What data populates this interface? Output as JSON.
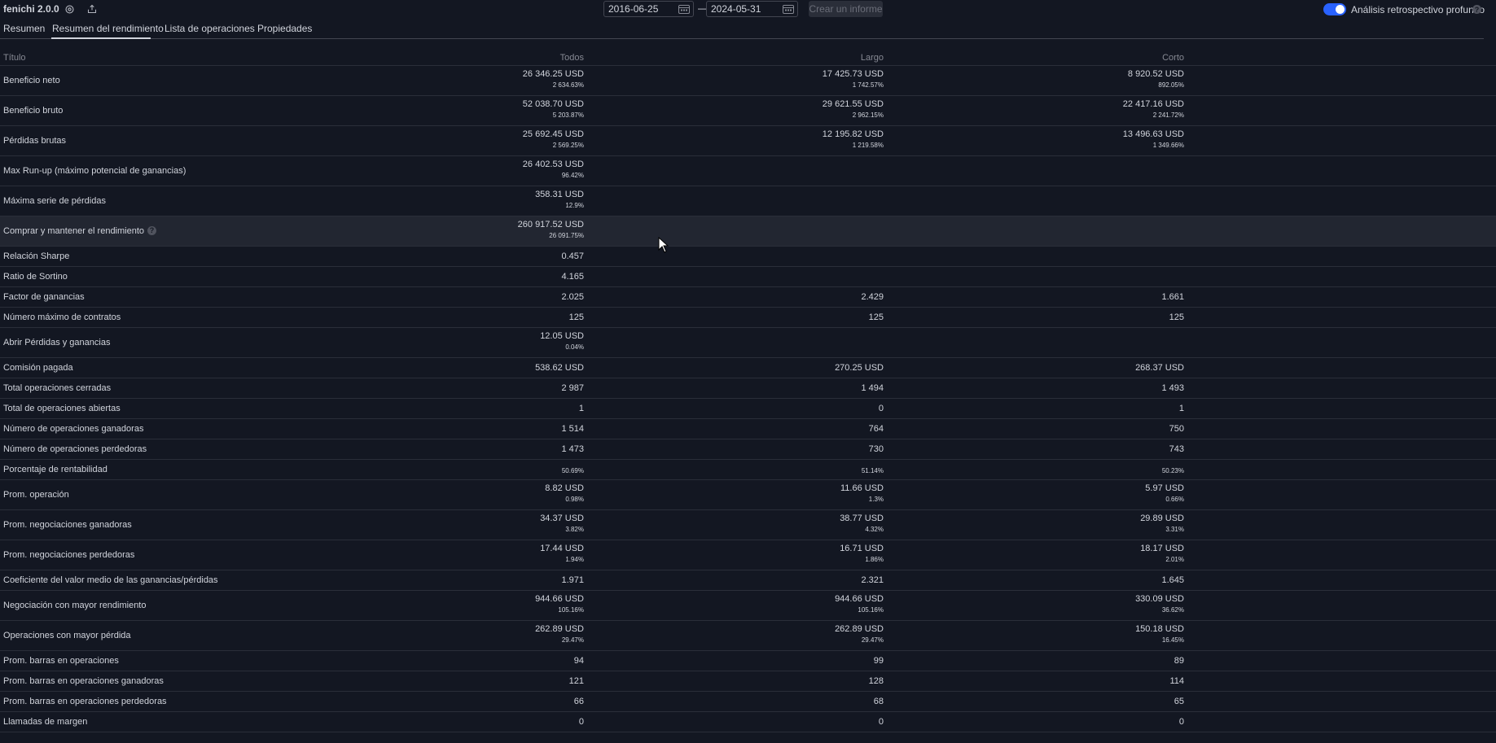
{
  "header": {
    "strategy_name": "fenichi 2.0.0",
    "settings_icon": "gear-icon",
    "export_icon": "export-icon",
    "date_from": "2016-06-25",
    "date_separator": "—",
    "date_to": "2024-05-31",
    "calendar_icon": "calendar-icon",
    "create_report_label": "Crear un informe",
    "deep_backtest_label": "Análisis retrospectivo profundo",
    "deep_backtest_enabled": true,
    "help_glyph": "?"
  },
  "tabs": [
    {
      "label": "Resumen",
      "active": false
    },
    {
      "label": "Resumen del rendimiento",
      "active": true
    },
    {
      "label": "Lista de operaciones",
      "active": false
    },
    {
      "label": "Propiedades",
      "active": false
    }
  ],
  "table": {
    "columns": [
      "Título",
      "Todos",
      "Largo",
      "Corto"
    ],
    "rows": [
      {
        "label": "Beneficio neto",
        "tall": true,
        "all": {
          "value": "26 346.25 USD",
          "pct": "2 634.63%"
        },
        "long": {
          "value": "17 425.73 USD",
          "pct": "1 742.57%"
        },
        "short": {
          "value": "8 920.52 USD",
          "pct": "892.05%"
        }
      },
      {
        "label": "Beneficio bruto",
        "tall": true,
        "all": {
          "value": "52 038.70 USD",
          "pct": "5 203.87%"
        },
        "long": {
          "value": "29 621.55 USD",
          "pct": "2 962.15%"
        },
        "short": {
          "value": "22 417.16 USD",
          "pct": "2 241.72%"
        }
      },
      {
        "label": "Pérdidas brutas",
        "tall": true,
        "all": {
          "value": "25 692.45 USD",
          "pct": "2 569.25%"
        },
        "long": {
          "value": "12 195.82 USD",
          "pct": "1 219.58%"
        },
        "short": {
          "value": "13 496.63 USD",
          "pct": "1 349.66%"
        }
      },
      {
        "label": "Max Run-up (máximo potencial de ganancias)",
        "tall": true,
        "all": {
          "value": "26 402.53 USD",
          "pct": "96.42%"
        }
      },
      {
        "label": "Máxima serie de pérdidas",
        "tall": true,
        "all": {
          "value": "358.31 USD",
          "pct": "12.9%"
        }
      },
      {
        "label": "Comprar y mantener el rendimiento",
        "tall": true,
        "help": true,
        "highlight": true,
        "all": {
          "value": "260 917.52 USD",
          "pct": "26 091.75%"
        }
      },
      {
        "label": "Relación Sharpe",
        "tall": false,
        "all": {
          "value": "0.457"
        }
      },
      {
        "label": "Ratio de Sortino",
        "tall": false,
        "all": {
          "value": "4.165"
        }
      },
      {
        "label": "Factor de ganancias",
        "tall": false,
        "all": {
          "value": "2.025"
        },
        "long": {
          "value": "2.429"
        },
        "short": {
          "value": "1.661"
        }
      },
      {
        "label": "Número máximo de contratos",
        "tall": false,
        "all": {
          "value": "125"
        },
        "long": {
          "value": "125"
        },
        "short": {
          "value": "125"
        }
      },
      {
        "label": "Abrir Pérdidas y ganancias",
        "tall": true,
        "all": {
          "value": "12.05 USD",
          "pct": "0.04%"
        }
      },
      {
        "label": "Comisión pagada",
        "tall": false,
        "all": {
          "value": "538.62 USD"
        },
        "long": {
          "value": "270.25 USD"
        },
        "short": {
          "value": "268.37 USD"
        }
      },
      {
        "label": "Total operaciones cerradas",
        "tall": false,
        "all": {
          "value": "2 987"
        },
        "long": {
          "value": "1 494"
        },
        "short": {
          "value": "1 493"
        }
      },
      {
        "label": "Total de operaciones abiertas",
        "tall": false,
        "all": {
          "value": "1"
        },
        "long": {
          "value": "0"
        },
        "short": {
          "value": "1"
        }
      },
      {
        "label": "Número de operaciones ganadoras",
        "tall": false,
        "all": {
          "value": "1 514"
        },
        "long": {
          "value": "764"
        },
        "short": {
          "value": "750"
        }
      },
      {
        "label": "Número de operaciones perdedoras",
        "tall": false,
        "all": {
          "value": "1 473"
        },
        "long": {
          "value": "730"
        },
        "short": {
          "value": "743"
        }
      },
      {
        "label": "Porcentaje de rentabilidad",
        "tall": false,
        "all": {
          "pct": "50.69%"
        },
        "long": {
          "pct": "51.14%"
        },
        "short": {
          "pct": "50.23%"
        }
      },
      {
        "label": "Prom. operación",
        "tall": true,
        "all": {
          "value": "8.82 USD",
          "pct": "0.98%"
        },
        "long": {
          "value": "11.66 USD",
          "pct": "1.3%"
        },
        "short": {
          "value": "5.97 USD",
          "pct": "0.66%"
        }
      },
      {
        "label": "Prom. negociaciones ganadoras",
        "tall": true,
        "all": {
          "value": "34.37 USD",
          "pct": "3.82%"
        },
        "long": {
          "value": "38.77 USD",
          "pct": "4.32%"
        },
        "short": {
          "value": "29.89 USD",
          "pct": "3.31%"
        }
      },
      {
        "label": "Prom. negociaciones perdedoras",
        "tall": true,
        "all": {
          "value": "17.44 USD",
          "pct": "1.94%"
        },
        "long": {
          "value": "16.71 USD",
          "pct": "1.86%"
        },
        "short": {
          "value": "18.17 USD",
          "pct": "2.01%"
        }
      },
      {
        "label": "Coeficiente del valor medio de las ganancias/pérdidas",
        "tall": false,
        "all": {
          "value": "1.971"
        },
        "long": {
          "value": "2.321"
        },
        "short": {
          "value": "1.645"
        }
      },
      {
        "label": "Negociación con mayor rendimiento",
        "tall": true,
        "all": {
          "value": "944.66 USD",
          "pct": "105.16%"
        },
        "long": {
          "value": "944.66 USD",
          "pct": "105.16%"
        },
        "short": {
          "value": "330.09 USD",
          "pct": "36.62%"
        }
      },
      {
        "label": "Operaciones con mayor pérdida",
        "tall": true,
        "all": {
          "value": "262.89 USD",
          "pct": "29.47%"
        },
        "long": {
          "value": "262.89 USD",
          "pct": "29.47%"
        },
        "short": {
          "value": "150.18 USD",
          "pct": "16.45%"
        }
      },
      {
        "label": "Prom. barras en operaciones",
        "tall": false,
        "all": {
          "value": "94"
        },
        "long": {
          "value": "99"
        },
        "short": {
          "value": "89"
        }
      },
      {
        "label": "Prom. barras en operaciones ganadoras",
        "tall": false,
        "all": {
          "value": "121"
        },
        "long": {
          "value": "128"
        },
        "short": {
          "value": "114"
        }
      },
      {
        "label": "Prom. barras en operaciones perdedoras",
        "tall": false,
        "all": {
          "value": "66"
        },
        "long": {
          "value": "68"
        },
        "short": {
          "value": "65"
        }
      },
      {
        "label": "Llamadas de margen",
        "tall": false,
        "all": {
          "value": "0"
        },
        "long": {
          "value": "0"
        },
        "short": {
          "value": "0"
        }
      }
    ]
  },
  "colors": {
    "background": "#131722",
    "text": "#d1d4dc",
    "muted": "#868993",
    "accent": "#2962ff",
    "highlight_row": "#222631"
  }
}
